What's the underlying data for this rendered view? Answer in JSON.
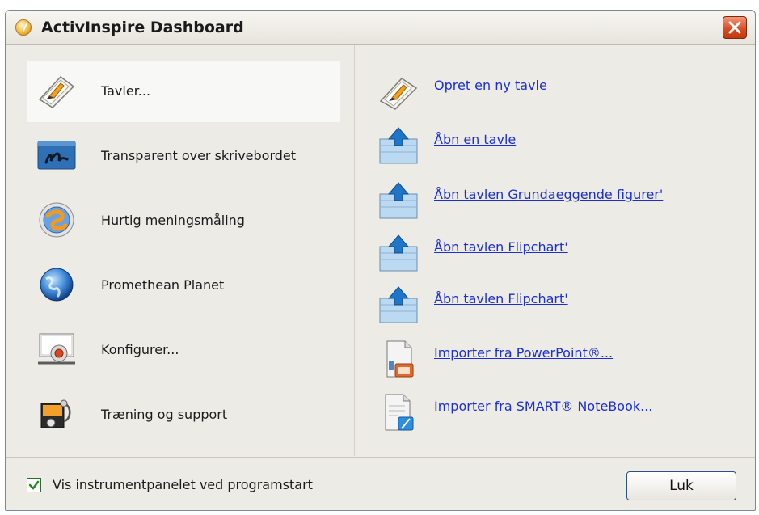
{
  "window": {
    "title": "ActivInspire Dashboard",
    "close_icon": "close-icon"
  },
  "left_menu": [
    {
      "label": "Tavler...",
      "icon": "flipchart-icon",
      "selected": true
    },
    {
      "label": "Transparent over skrivebordet",
      "icon": "desktop-annotate-icon",
      "selected": false
    },
    {
      "label": "Hurtig meningsmåling",
      "icon": "express-poll-icon",
      "selected": false
    },
    {
      "label": "Promethean Planet",
      "icon": "globe-icon",
      "selected": false
    },
    {
      "label": "Konfigurer...",
      "icon": "configure-icon",
      "selected": false
    },
    {
      "label": "Træning og support",
      "icon": "training-support-icon",
      "selected": false
    }
  ],
  "right_links": [
    {
      "label": "Opret en ny tavle",
      "icon": "new-flipchart-icon"
    },
    {
      "label": "Åbn en tavle",
      "icon": "open-folder-icon"
    },
    {
      "label": "Åbn tavlen Grundaeggende figurer'",
      "icon": "open-folder-icon"
    },
    {
      "label": "Åbn tavlen Flipchart'",
      "icon": "open-folder-icon"
    },
    {
      "label": "Åbn tavlen Flipchart'",
      "icon": "open-folder-icon"
    },
    {
      "label": "Importer fra PowerPoint®...",
      "icon": "powerpoint-import-icon"
    },
    {
      "label": "Importer fra SMART® NoteBook...",
      "icon": "notebook-import-icon"
    }
  ],
  "footer": {
    "show_at_startup_label": "Vis instrumentpanelet ved programstart",
    "show_at_startup_checked": true,
    "close_button_label": "Luk"
  },
  "colors": {
    "link": "#1c2fd6",
    "window_bg": "#ecebe5",
    "close_button": "#d8491f"
  }
}
